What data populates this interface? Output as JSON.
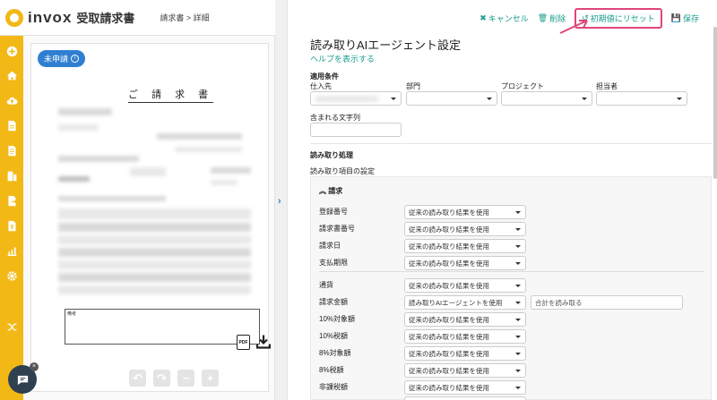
{
  "header": {
    "logo_text": "invox",
    "logo_sub": "受取請求書",
    "breadcrumb": "請求書 > 詳細"
  },
  "sidebar": {
    "items": [
      {
        "icon": "plus-circle-icon"
      },
      {
        "icon": "home-icon"
      },
      {
        "icon": "cloud-upload-icon"
      },
      {
        "icon": "document-icon"
      },
      {
        "icon": "document-list-icon"
      },
      {
        "icon": "building-icon"
      },
      {
        "icon": "document-export-icon"
      },
      {
        "icon": "document-yen-icon"
      },
      {
        "icon": "analytics-icon"
      },
      {
        "icon": "gear-icon"
      },
      {
        "icon": "shuffle-icon"
      }
    ],
    "color": "#f2b816"
  },
  "document": {
    "status_badge": "未申請",
    "title": "ご 請 求 書",
    "memo_label": "備考",
    "tools": [
      "↶",
      "↷",
      "−",
      "+"
    ],
    "pdf_label": "PDF"
  },
  "splitter": {
    "toggle": "›"
  },
  "actions": {
    "cancel": "キャンセル",
    "delete": "削除",
    "reset": "初期値にリセット",
    "save": "保存"
  },
  "settings": {
    "title": "読み取りAIエージェント設定",
    "help": "ヘルプを表示する",
    "conditions_label": "適用条件",
    "supplier_label": "仕入先",
    "department_label": "部門",
    "project_label": "プロジェクト",
    "assignee_label": "担当者",
    "contains_label": "含まれる文字列",
    "processing_label": "読み取り処理",
    "items_label": "読み取り項目の設定",
    "group_label": "請求",
    "rows": [
      {
        "label": "登録番号",
        "value": "従来の読み取り結果を使用"
      },
      {
        "label": "請求書番号",
        "value": "従来の読み取り結果を使用"
      },
      {
        "label": "請求日",
        "value": "従来の読み取り結果を使用"
      },
      {
        "label": "支払期限",
        "value": "従来の読み取り結果を使用"
      },
      {
        "label": "通貨",
        "value": "従来の読み取り結果を使用"
      },
      {
        "label": "請求金額",
        "value": "読み取りAIエージェントを使用",
        "extra": "合計を読み取る"
      },
      {
        "label": "10%対象額",
        "value": "従来の読み取り結果を使用"
      },
      {
        "label": "10%税額",
        "value": "従来の読み取り結果を使用"
      },
      {
        "label": "8%対象額",
        "value": "従来の読み取り結果を使用"
      },
      {
        "label": "8%税額",
        "value": "従来の読み取り結果を使用"
      },
      {
        "label": "非課税額",
        "value": "従来の読み取り結果を使用"
      },
      {
        "label": "",
        "value": ""
      }
    ]
  },
  "colors": {
    "accent": "#1a9e8f",
    "highlight": "#e0457b",
    "badge": "#2f7fd1"
  }
}
